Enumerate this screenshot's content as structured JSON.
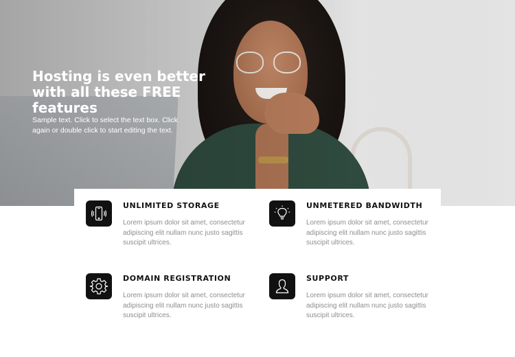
{
  "hero": {
    "title": "Hosting is even better with all these FREE features",
    "text": "Sample text. Click to select the text box. Click again or double click to start editing the text."
  },
  "features": [
    {
      "title": "UNLIMITED STORAGE",
      "icon": "smartphone-icon",
      "text": "Lorem ipsum dolor sit amet, consectetur adipiscing elit nullam nunc justo sagittis suscipit ultrices."
    },
    {
      "title": "UNMETERED BANDWIDTH",
      "icon": "lightbulb-icon",
      "text": "Lorem ipsum dolor sit amet, consectetur adipiscing elit nullam nunc justo sagittis suscipit ultrices."
    },
    {
      "title": "DOMAIN REGISTRATION",
      "icon": "gear-icon",
      "text": "Lorem ipsum dolor sit amet, consectetur adipiscing elit nullam nunc justo sagittis suscipit ultrices."
    },
    {
      "title": "SUPPORT",
      "icon": "user-icon",
      "text": "Lorem ipsum dolor sit amet, consectetur adipiscing elit nullam nunc justo sagittis suscipit ultrices."
    }
  ],
  "colors": {
    "icon_background": "#111111",
    "heading": "#111111",
    "body_text": "#8d8d8d",
    "hero_text": "#ffffff"
  }
}
